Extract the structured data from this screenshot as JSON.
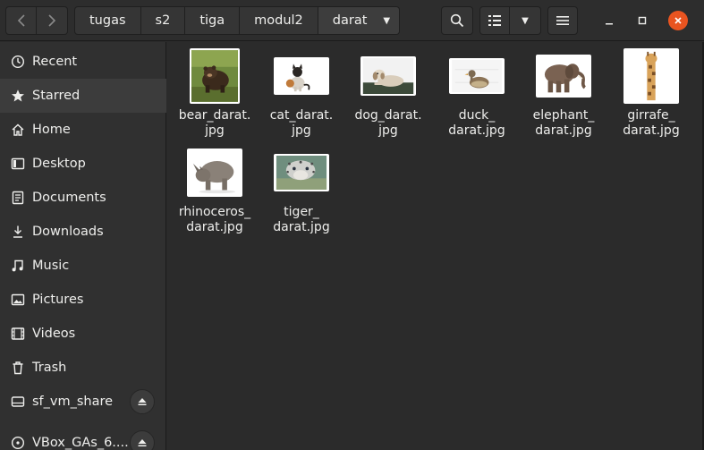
{
  "path": [
    "tugas",
    "s2",
    "tiga",
    "modul2",
    "darat"
  ],
  "sidebar": {
    "items": [
      {
        "label": "Recent",
        "icon": "clock-icon"
      },
      {
        "label": "Starred",
        "icon": "star-icon"
      },
      {
        "label": "Home",
        "icon": "home-icon"
      },
      {
        "label": "Desktop",
        "icon": "desktop-icon"
      },
      {
        "label": "Documents",
        "icon": "document-icon"
      },
      {
        "label": "Downloads",
        "icon": "download-icon"
      },
      {
        "label": "Music",
        "icon": "music-icon"
      },
      {
        "label": "Pictures",
        "icon": "picture-icon"
      },
      {
        "label": "Videos",
        "icon": "video-icon"
      },
      {
        "label": "Trash",
        "icon": "trash-icon"
      },
      {
        "label": "sf_vm_share",
        "icon": "drive-icon"
      },
      {
        "label": "VBox_GAs_6....",
        "icon": "disc-icon"
      }
    ]
  },
  "files": [
    {
      "line1": "bear_darat.",
      "line2": "jpg",
      "thumb": "bear"
    },
    {
      "line1": "cat_darat.",
      "line2": "jpg",
      "thumb": "cat"
    },
    {
      "line1": "dog_darat.",
      "line2": "jpg",
      "thumb": "dog"
    },
    {
      "line1": "duck_",
      "line2": "darat.jpg",
      "thumb": "duck"
    },
    {
      "line1": "elephant_",
      "line2": "darat.jpg",
      "thumb": "elephant"
    },
    {
      "line1": "girrafe_",
      "line2": "darat.jpg",
      "thumb": "giraffe"
    },
    {
      "line1": "rhinoceros_",
      "line2": "darat.jpg",
      "thumb": "rhino"
    },
    {
      "line1": "tiger_",
      "line2": "darat.jpg",
      "thumb": "tiger"
    }
  ],
  "colors": {
    "accent": "#e95420",
    "background": "#2b2b2b",
    "sidebar": "#303030"
  }
}
